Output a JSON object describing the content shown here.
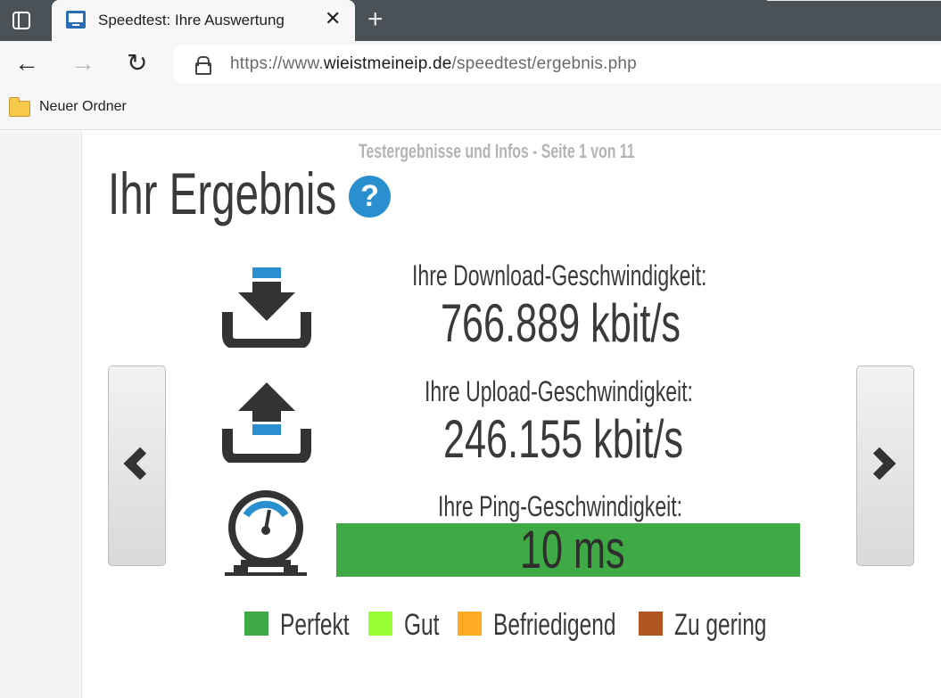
{
  "browser": {
    "tab_title": "Speedtest: Ihre Auswertung",
    "tab_close": "✕",
    "new_tab": "+",
    "url_prefix": "https://www.",
    "url_domain": "wieistmeineip.de",
    "url_path": "/speedtest/ergebnis.php",
    "bookmark_folder": "Neuer Ordner"
  },
  "page": {
    "page_info": "Testergebnisse und Infos - Seite 1 von 11",
    "title": "Ihr Ergebnis",
    "help": "?",
    "download": {
      "label": "Ihre Download-Geschwindigkeit:",
      "value": "766.889 kbit/s"
    },
    "upload": {
      "label": "Ihre Upload-Geschwindigkeit:",
      "value": "246.155 kbit/s"
    },
    "ping": {
      "label": "Ihre Ping-Geschwindigkeit:",
      "value": "10 ms",
      "color": "#3faa45"
    }
  },
  "legend": [
    {
      "label": "Perfekt",
      "color": "#3faa45"
    },
    {
      "label": "Gut",
      "color": "#99ff33"
    },
    {
      "label": "Befriedigend",
      "color": "#ffaa22"
    },
    {
      "label": "Zu gering",
      "color": "#b05522"
    }
  ]
}
